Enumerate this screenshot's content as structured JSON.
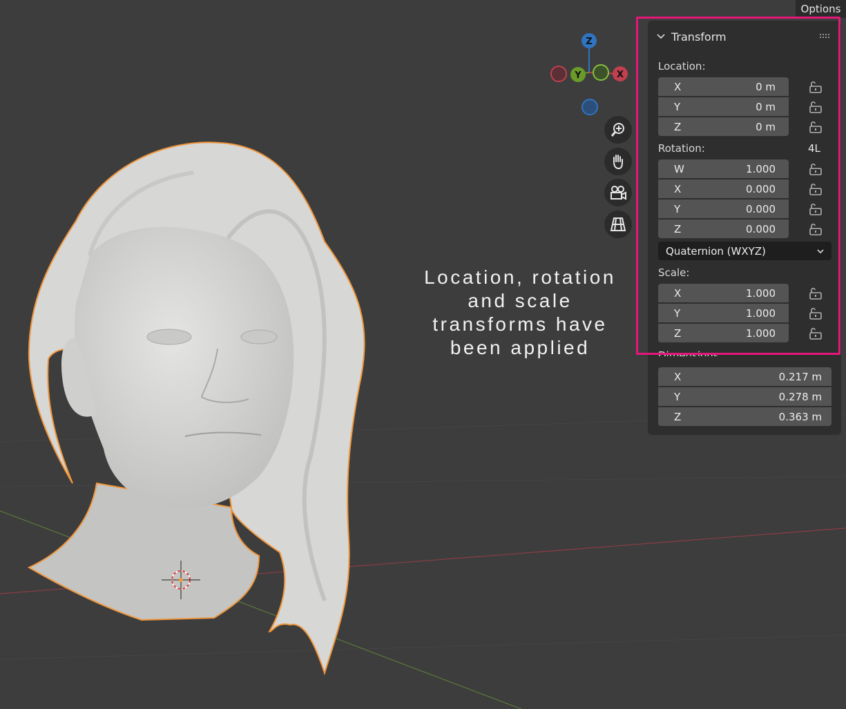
{
  "header": {
    "options_label": "Options"
  },
  "annotation": {
    "lines": [
      "Location, rotation",
      "and scale",
      "transforms have",
      "been applied"
    ]
  },
  "gizmo": {
    "z": "Z",
    "y": "Y",
    "x": "X"
  },
  "nav_buttons": [
    "zoom-icon",
    "hand-pan-icon",
    "camera-icon",
    "perspective-grid-icon"
  ],
  "transform": {
    "title": "Transform",
    "location": {
      "label": "Location:",
      "rows": [
        {
          "axis": "X",
          "value": "0 m"
        },
        {
          "axis": "Y",
          "value": "0 m"
        },
        {
          "axis": "Z",
          "value": "0 m"
        }
      ]
    },
    "rotation": {
      "label": "Rotation:",
      "mode_short": "4L",
      "rows": [
        {
          "axis": "W",
          "value": "1.000"
        },
        {
          "axis": "X",
          "value": "0.000"
        },
        {
          "axis": "Y",
          "value": "0.000"
        },
        {
          "axis": "Z",
          "value": "0.000"
        }
      ],
      "mode": "Quaternion (WXYZ)"
    },
    "scale": {
      "label": "Scale:",
      "rows": [
        {
          "axis": "X",
          "value": "1.000"
        },
        {
          "axis": "Y",
          "value": "1.000"
        },
        {
          "axis": "Z",
          "value": "1.000"
        }
      ]
    },
    "dimensions": {
      "label": "Dimensions:",
      "rows": [
        {
          "axis": "X",
          "value": "0.217 m"
        },
        {
          "axis": "Y",
          "value": "0.278 m"
        },
        {
          "axis": "Z",
          "value": "0.363 m"
        }
      ]
    }
  },
  "colors": {
    "highlight": "#e5177b",
    "selection_outline": "#f0963c",
    "axis_x": "#c0404f",
    "axis_y": "#6a9a2a",
    "axis_z": "#2f74c0"
  }
}
